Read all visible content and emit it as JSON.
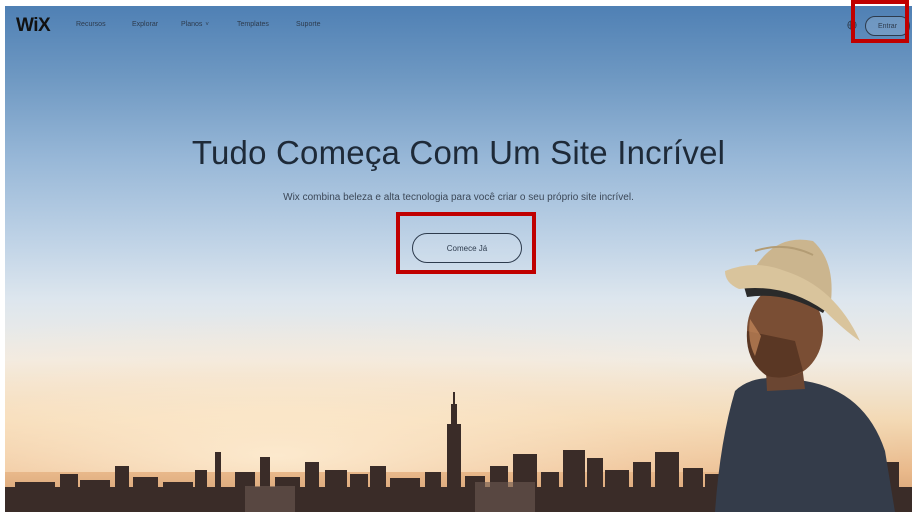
{
  "nav": {
    "logo": "WiX",
    "links": [
      "Recursos",
      "Explorar",
      "Planos",
      "Templates",
      "Suporte"
    ],
    "plans_chevron": "˅",
    "globe_icon": "globe-icon",
    "login_label": "Entrar"
  },
  "hero": {
    "headline": "Tudo Começa Com Um Site Incrível",
    "subline": "Wix combina beleza e alta tecnologia para você criar o seu próprio site incrível.",
    "cta_label": "Comece Já"
  },
  "colors": {
    "highlight": "#c00000",
    "text_dark": "#1e2a38",
    "sky_top": "#4f80b4"
  }
}
